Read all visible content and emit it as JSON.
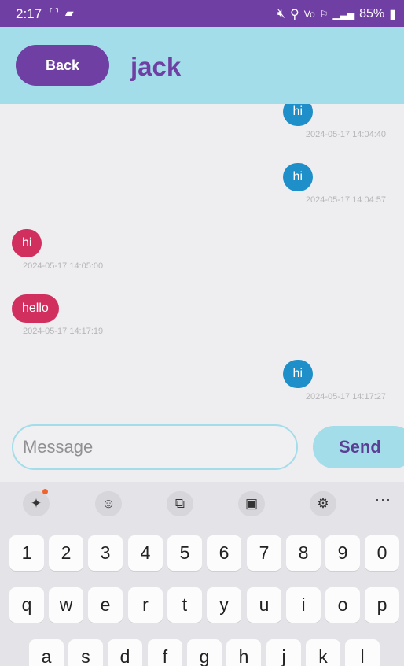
{
  "status_bar": {
    "time": "2:17",
    "left_icons": "⸢⸣ ▰",
    "right_icons": [
      "mute-icon",
      "location-icon",
      "volte-icon",
      "wifi-calling-icon",
      "signal-icon",
      "battery-icon"
    ],
    "battery": "85%"
  },
  "header": {
    "back_label": "Back",
    "title": "jack",
    "bg_color": "#a2dde9",
    "accent_color": "#6f3fa3"
  },
  "messages": [
    {
      "direction": "sent",
      "text": "hi",
      "time": "2024-05-17 14:04:40"
    },
    {
      "direction": "sent",
      "text": "hi",
      "time": "2024-05-17 14:04:57"
    },
    {
      "direction": "received",
      "text": "hi",
      "time": "2024-05-17 14:05:00"
    },
    {
      "direction": "received",
      "text": "hello",
      "time": "2024-05-17 14:17:19"
    },
    {
      "direction": "sent",
      "text": "hi",
      "time": "2024-05-17 14:17:27"
    }
  ],
  "composer": {
    "placeholder": "Message",
    "send_label": "Send"
  },
  "keyboard": {
    "toolbar": [
      "sparkle-icon",
      "emoji-icon",
      "translate-icon",
      "clipboard-icon",
      "settings-icon"
    ],
    "more": "···",
    "row_numbers": [
      "1",
      "2",
      "3",
      "4",
      "5",
      "6",
      "7",
      "8",
      "9",
      "0"
    ],
    "row_q": [
      "q",
      "w",
      "e",
      "r",
      "t",
      "y",
      "u",
      "i",
      "o",
      "p"
    ],
    "row_a": [
      "a",
      "s",
      "d",
      "f",
      "g",
      "h",
      "j",
      "k",
      "l"
    ]
  },
  "colors": {
    "sent_bubble": "#1f8fc9",
    "received_bubble": "#d1305f"
  }
}
